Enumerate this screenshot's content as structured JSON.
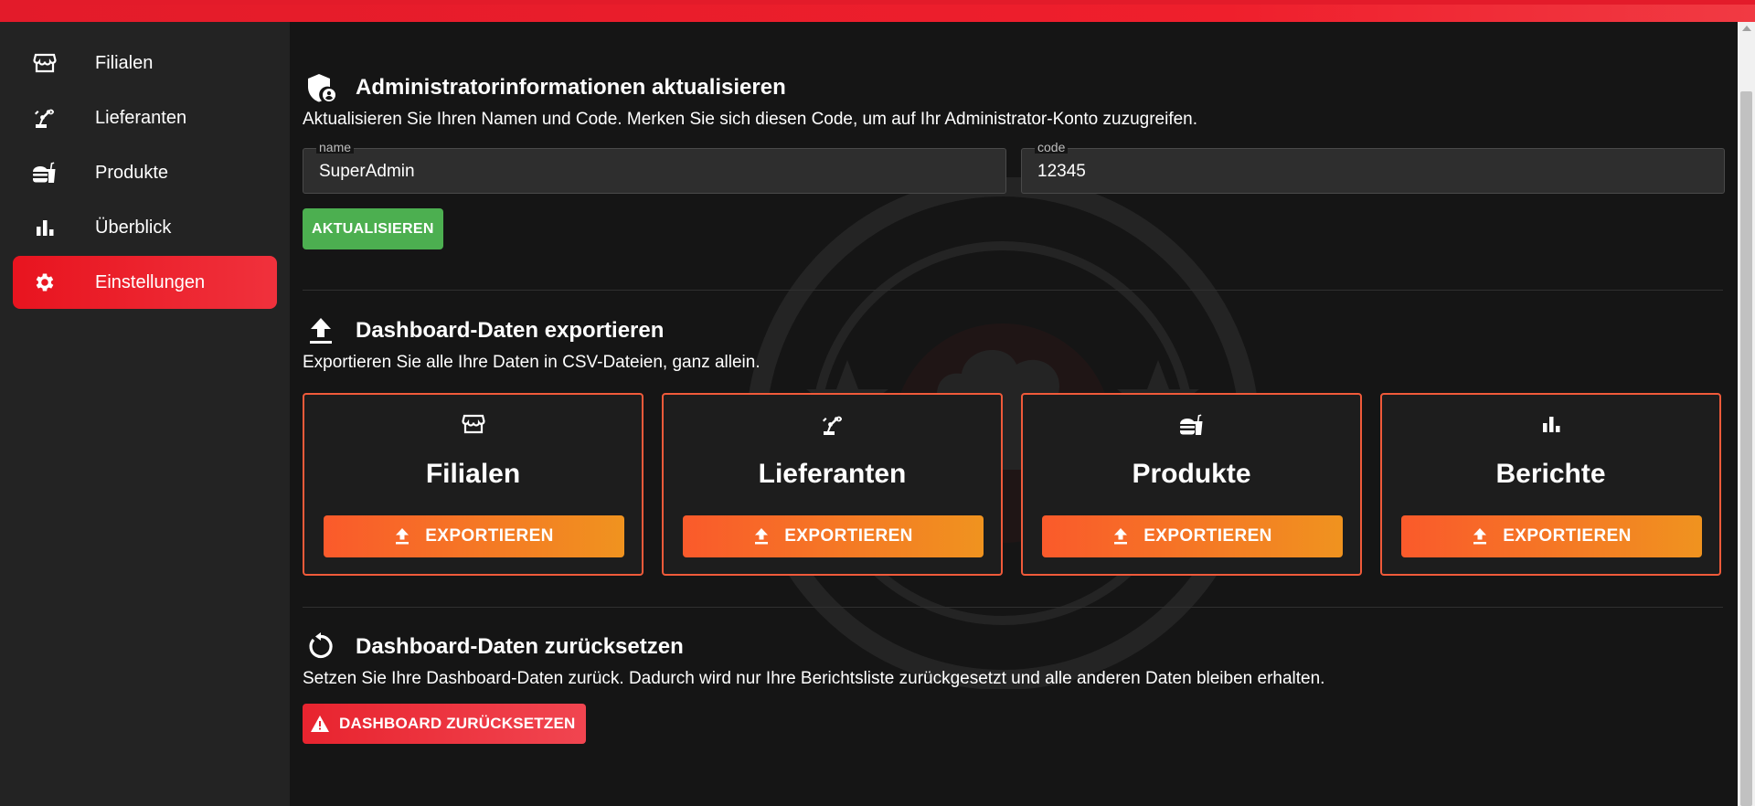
{
  "sidebar": {
    "items": [
      {
        "label": "Filialen",
        "icon": "store-icon"
      },
      {
        "label": "Lieferanten",
        "icon": "robot-arm-icon"
      },
      {
        "label": "Produkte",
        "icon": "food-icon"
      },
      {
        "label": "Überblick",
        "icon": "bar-chart-icon"
      },
      {
        "label": "Einstellungen",
        "icon": "gear-icon",
        "active": true
      }
    ]
  },
  "admin": {
    "title": "Administratorinformationen aktualisieren",
    "description": "Aktualisieren Sie Ihren Namen und Code. Merken Sie sich diesen Code, um auf Ihr Administrator-Konto zuzugreifen.",
    "name_label": "name",
    "name_value": "SuperAdmin",
    "code_label": "code",
    "code_value": "12345",
    "update_button": "AKTUALISIEREN"
  },
  "export": {
    "title": "Dashboard-Daten exportieren",
    "description": "Exportieren Sie alle Ihre Daten in CSV-Dateien, ganz allein.",
    "cards": [
      {
        "title": "Filialen",
        "button": "EXPORTIEREN",
        "icon": "store-icon"
      },
      {
        "title": "Lieferanten",
        "button": "EXPORTIEREN",
        "icon": "robot-arm-icon"
      },
      {
        "title": "Produkte",
        "button": "EXPORTIEREN",
        "icon": "food-icon"
      },
      {
        "title": "Berichte",
        "button": "EXPORTIEREN",
        "icon": "bar-chart-icon"
      }
    ]
  },
  "reset": {
    "title": "Dashboard-Daten zurücksetzen",
    "description": "Setzen Sie Ihre Dashboard-Daten zurück. Dadurch wird nur Ihre Berichtsliste zurückgesetzt und alle anderen Daten bleiben erhalten.",
    "button": "DASHBOARD ZURÜCKSETZEN"
  },
  "colors": {
    "accent_red": "#e8141f",
    "export_orange": "#fa5a2b",
    "update_green": "#4caf50",
    "background": "#151515",
    "sidebar": "#232323"
  }
}
